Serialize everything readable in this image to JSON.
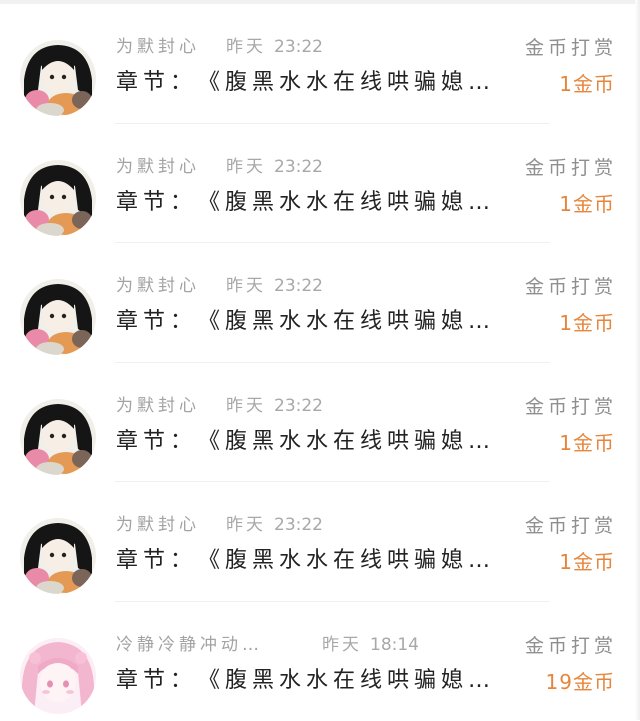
{
  "records": [
    {
      "user": "为默封心",
      "date": "昨天",
      "time": "23:22",
      "type": "金币打赏",
      "chapter_prefix": "章节：",
      "chapter_title": "《腹黑水水在线哄骗媳…",
      "amount": "1金币",
      "avatar": "dark-hair-anime-avatar"
    },
    {
      "user": "为默封心",
      "date": "昨天",
      "time": "23:22",
      "type": "金币打赏",
      "chapter_prefix": "章节：",
      "chapter_title": "《腹黑水水在线哄骗媳…",
      "amount": "1金币",
      "avatar": "dark-hair-anime-avatar"
    },
    {
      "user": "为默封心",
      "date": "昨天",
      "time": "23:22",
      "type": "金币打赏",
      "chapter_prefix": "章节：",
      "chapter_title": "《腹黑水水在线哄骗媳…",
      "amount": "1金币",
      "avatar": "dark-hair-anime-avatar"
    },
    {
      "user": "为默封心",
      "date": "昨天",
      "time": "23:22",
      "type": "金币打赏",
      "chapter_prefix": "章节：",
      "chapter_title": "《腹黑水水在线哄骗媳…",
      "amount": "1金币",
      "avatar": "dark-hair-anime-avatar"
    },
    {
      "user": "为默封心",
      "date": "昨天",
      "time": "23:22",
      "type": "金币打赏",
      "chapter_prefix": "章节：",
      "chapter_title": "《腹黑水水在线哄骗媳…",
      "amount": "1金币",
      "avatar": "dark-hair-anime-avatar"
    },
    {
      "user": "冷静冷静冲动…",
      "date": "昨天",
      "time": "18:14",
      "type": "金币打赏",
      "chapter_prefix": "章节：",
      "chapter_title": "《腹黑水水在线哄骗媳…",
      "amount": "19金币",
      "avatar": "pink-hair-anime-avatar"
    }
  ],
  "colors": {
    "accent_amount": "#e6863c",
    "muted_text": "#a3a3a3",
    "primary_text": "#222222"
  }
}
